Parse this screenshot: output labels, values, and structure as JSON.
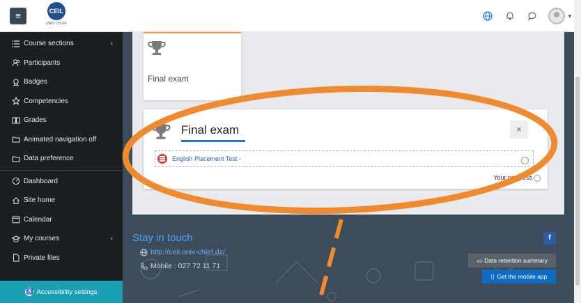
{
  "navbar": {
    "menu_icon": "hamburger-icon",
    "logo_text": "CEIL",
    "logo_caption": "UNIV CHLEF",
    "icons": [
      "globe-icon",
      "bell-icon",
      "chat-icon",
      "avatar"
    ]
  },
  "sidebar": {
    "items": [
      {
        "label": "Course sections",
        "icon": "list-icon",
        "has_chevron": true
      },
      {
        "label": "Participants",
        "icon": "users-icon"
      },
      {
        "label": "Badges",
        "icon": "badge-icon"
      },
      {
        "label": "Competencies",
        "icon": "star-icon"
      },
      {
        "label": "Grades",
        "icon": "book-icon"
      },
      {
        "label": "Animated navigation off",
        "icon": "folder-icon"
      },
      {
        "label": "Data preference",
        "icon": "folder-icon"
      },
      {
        "label": "Dashboard",
        "icon": "gauge-icon"
      },
      {
        "label": "Site home",
        "icon": "home-icon"
      },
      {
        "label": "Calendar",
        "icon": "calendar-icon"
      },
      {
        "label": "My courses",
        "icon": "graduation-icon",
        "has_chevron": true
      },
      {
        "label": "Private files",
        "icon": "file-icon"
      }
    ],
    "accessibility": "Accessibility settings"
  },
  "main": {
    "card_label": "Final exam",
    "modal": {
      "title": "Final exam",
      "close_symbol": "×",
      "activity_link": "English Placement Test -",
      "progress_label": "Your progress"
    },
    "footer": {
      "stay_title": "Stay in touch",
      "url": "http://ceil.univ-chlef.dz/",
      "phone": "Mobile : 027 72 11 71",
      "facebook_symbol": "f",
      "retention_button": "Data retention summary",
      "mobile_button": "Get the mobile app"
    }
  },
  "colors": {
    "sidebar_bg": "#1a1f24",
    "accent_blue": "#1a73e8",
    "annotation_orange": "#f08a2e",
    "accessibility_bg": "#1b9fb3"
  }
}
